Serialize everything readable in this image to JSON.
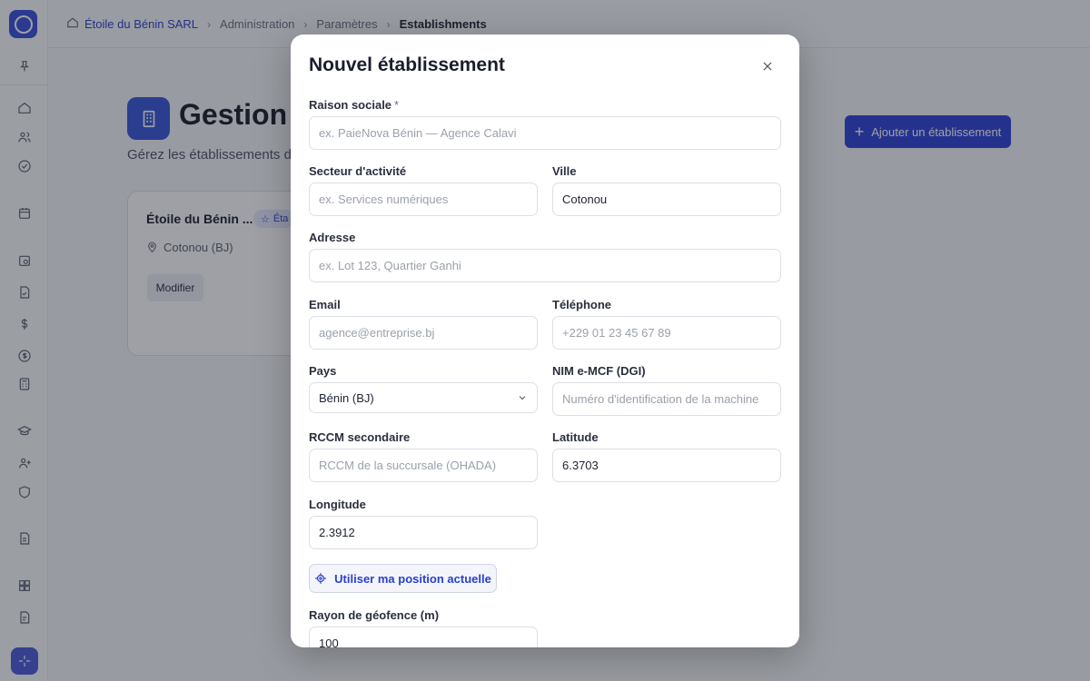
{
  "breadcrumb": {
    "items": [
      "Étoile du Bénin SARL",
      "Administration",
      "Paramètres",
      "Establishments"
    ]
  },
  "page": {
    "title": "Gestion d",
    "subtitle": "Gérez les établissements d",
    "add_button": "Ajouter un établissement"
  },
  "card": {
    "title": "Étoile du Bénin ...",
    "badge": "Éta",
    "location": "Cotonou (BJ)",
    "edit_button": "Modifier"
  },
  "modal": {
    "title": "Nouvel établissement",
    "fields": {
      "raison_sociale": {
        "label": "Raison sociale",
        "required_mark": "*",
        "placeholder": "ex. PaieNova Bénin — Agence Calavi",
        "value": ""
      },
      "secteur": {
        "label": "Secteur d'activité",
        "placeholder": "ex. Services numériques",
        "value": ""
      },
      "ville": {
        "label": "Ville",
        "placeholder": "",
        "value": "Cotonou"
      },
      "adresse": {
        "label": "Adresse",
        "placeholder": "ex. Lot 123, Quartier Ganhi",
        "value": ""
      },
      "email": {
        "label": "Email",
        "placeholder": "agence@entreprise.bj",
        "value": ""
      },
      "telephone": {
        "label": "Téléphone",
        "placeholder": "+229 01 23 45 67 89",
        "value": ""
      },
      "pays": {
        "label": "Pays",
        "value": "Bénin (BJ)"
      },
      "nim": {
        "label": "NIM e-MCF (DGI)",
        "placeholder": "Numéro d'identification de la machine",
        "value": ""
      },
      "rccm": {
        "label": "RCCM secondaire",
        "placeholder": "RCCM de la succursale (OHADA)",
        "value": ""
      },
      "latitude": {
        "label": "Latitude",
        "placeholder": "",
        "value": "6.3703"
      },
      "longitude": {
        "label": "Longitude",
        "placeholder": "",
        "value": "2.3912"
      },
      "rayon": {
        "label": "Rayon de géofence (m)",
        "placeholder": "",
        "value": "100"
      }
    },
    "geo_button": "Utiliser ma position actuelle"
  },
  "colors": {
    "accent": "#2f43d6",
    "overlay": "#181c28"
  }
}
